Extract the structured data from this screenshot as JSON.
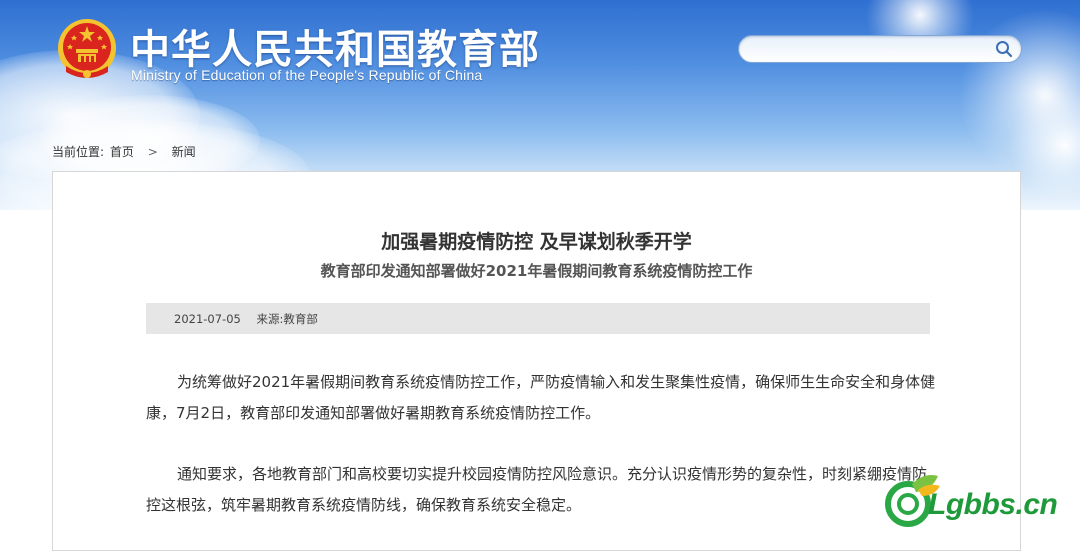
{
  "header": {
    "title_cn": "中华人民共和国教育部",
    "title_en": "Ministry of Education of the People's Republic of China"
  },
  "search": {
    "value": "",
    "placeholder": ""
  },
  "breadcrumb": {
    "prefix": "当前位置:",
    "home": "首页",
    "separator": ">",
    "current": "新闻"
  },
  "article": {
    "title": "加强暑期疫情防控 及早谋划秋季开学",
    "subtitle": "教育部印发通知部署做好2021年暑假期间教育系统疫情防控工作",
    "date": "2021-07-05",
    "source": "来源:教育部",
    "paragraphs": [
      "为统筹做好2021年暑假期间教育系统疫情防控工作，严防疫情输入和发生聚集性疫情，确保师生生命安全和身体健康，7月2日，教育部印发通知部署做好暑期教育系统疫情防控工作。",
      "通知要求，各地教育部门和高校要切实提升校园疫情防控风险意识。充分认识疫情形势的复杂性，时刻紧绷疫情防控这根弦，筑牢暑期教育系统疫情防线，确保教育系统安全稳定。"
    ]
  },
  "watermark": {
    "text": "Lgbbs.cn"
  },
  "colors": {
    "sky_top": "#2f6fd0",
    "sky_bottom": "#eef6fd",
    "emblem_red": "#d9251d",
    "emblem_gold": "#f4c430",
    "meta_bar": "#e6e6e6",
    "watermark_green": "#1f9a3a"
  },
  "icons": {
    "emblem": "national-emblem-icon",
    "search": "search-icon",
    "breadcrumb_separator": "chevron-right-icon",
    "watermark_logo": "leaf-logo-icon"
  }
}
